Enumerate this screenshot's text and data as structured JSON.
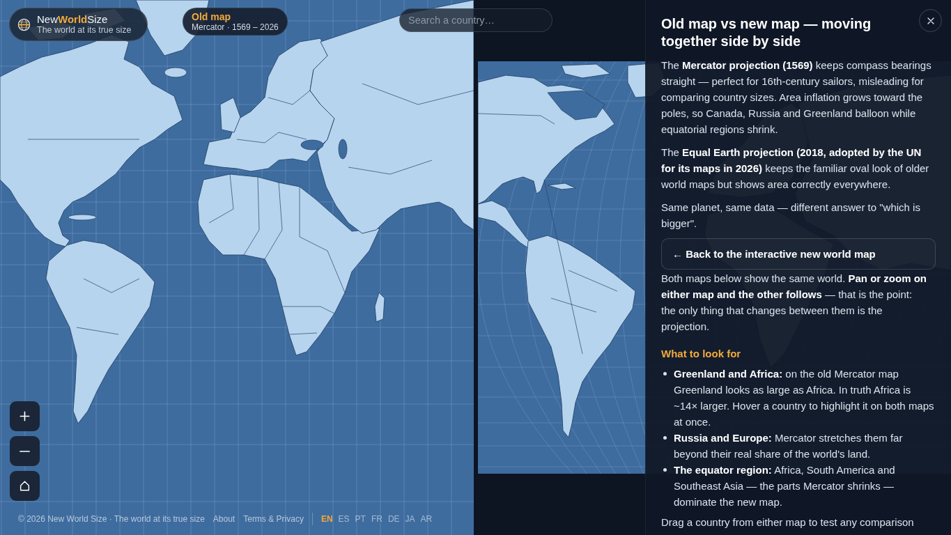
{
  "brand": {
    "name": [
      {
        "text": "New",
        "accent": false
      },
      {
        "text": "World",
        "accent": true
      },
      {
        "text": "Size",
        "accent": false
      }
    ],
    "tagline": "The world at its true size"
  },
  "map_label": {
    "title": "Old map",
    "subtitle": "Mercator · 1569 – 2026"
  },
  "search": {
    "placeholder": "Search a country…"
  },
  "footer": {
    "copyright": "© 2026 New World Size · The world at its true size",
    "links": [
      "About",
      "Terms & Privacy"
    ],
    "languages": [
      {
        "label": "EN",
        "selected": true
      },
      {
        "label": "ES",
        "selected": false
      },
      {
        "label": "PT",
        "selected": false
      },
      {
        "label": "FR",
        "selected": false
      },
      {
        "label": "DE",
        "selected": false
      },
      {
        "label": "JA",
        "selected": false
      },
      {
        "label": "AR",
        "selected": false
      }
    ]
  },
  "panel": {
    "title": "Old map vs new map — moving together side by side",
    "paragraphs": [
      "The **Mercator projection (1569)** keeps compass bearings straight — perfect for 16th-century sailors, misleading for comparing country sizes. Area inflation grows toward the poles, so Canada, Russia and Greenland balloon while equatorial regions shrink.",
      "The **Equal Earth projection (2018, adopted by the UN for its maps in 2026)** keeps the familiar oval look of older world maps but shows area correctly everywhere.",
      "Same planet, same data — different answer to \"which is bigger\"."
    ],
    "back_button": "← Back to the interactive new world map",
    "sync_note": "Both maps below show the same world. **Pan or zoom on either map and the other follows** — that is the point: the only thing that changes between them is the projection.",
    "section_heading": "What to look for",
    "tips": [
      "**Greenland and Africa:** on the old Mercator map Greenland looks as large as Africa. In truth Africa is ~14× larger. Hover a country to highlight it on both maps at once.",
      "**Russia and Europe:** Mercator stretches them far beyond their real share of the world's land.",
      "**The equator region:** Africa, South America and Southeast Asia — the parts Mercator shrinks — dominate the new map."
    ],
    "closing": "Drag a country from either map to test any comparison"
  }
}
